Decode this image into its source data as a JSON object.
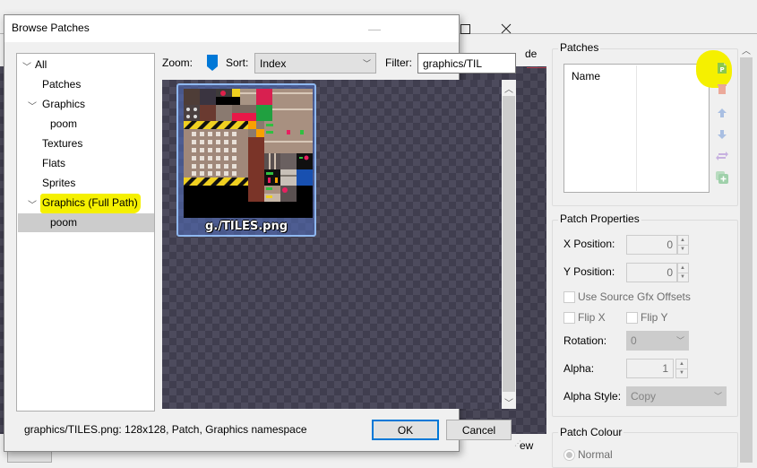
{
  "background": {
    "partial_label_right": "de",
    "partial_label_bottom": "ew"
  },
  "dialog": {
    "title": "Browse Patches",
    "window_controls": {
      "minimize": "—",
      "maximize": "☐",
      "close": "✕"
    },
    "tree": {
      "items": [
        {
          "label": "All",
          "expanded": true,
          "level": 0
        },
        {
          "label": "Patches",
          "level": 1
        },
        {
          "label": "Graphics",
          "expanded": true,
          "level": 1
        },
        {
          "label": "poom",
          "level": 2
        },
        {
          "label": "Textures",
          "level": 1
        },
        {
          "label": "Flats",
          "level": 1
        },
        {
          "label": "Sprites",
          "level": 1
        },
        {
          "label": "Graphics (Full Path)",
          "expanded": true,
          "level": 1,
          "highlighted": true
        },
        {
          "label": "poom",
          "level": 2,
          "selected": true
        }
      ]
    },
    "toolbar": {
      "zoom_label": "Zoom:",
      "sort_label": "Sort:",
      "sort_value": "Index",
      "filter_label": "Filter:",
      "filter_value": "graphics/TIL"
    },
    "gallery": {
      "items": [
        {
          "name": "g./TILES.png",
          "selected": true
        }
      ]
    },
    "status": "graphics/TILES.png: 128x128, Patch, Graphics namespace",
    "ok_label": "OK",
    "cancel_label": "Cancel"
  },
  "right_panel": {
    "patches": {
      "title": "Patches",
      "column_name": "Name",
      "icons": [
        "add-patch-icon",
        "remove-patch-icon",
        "move-up-icon",
        "move-down-icon",
        "replace-patch-icon",
        "duplicate-patch-icon"
      ]
    },
    "patch_properties": {
      "title": "Patch Properties",
      "x_position_label": "X Position:",
      "x_position_value": "0",
      "y_position_label": "Y Position:",
      "y_position_value": "0",
      "use_source_offsets_label": "Use Source Gfx Offsets",
      "flip_x_label": "Flip X",
      "flip_y_label": "Flip Y",
      "rotation_label": "Rotation:",
      "rotation_value": "0",
      "alpha_label": "Alpha:",
      "alpha_value": "1",
      "alpha_style_label": "Alpha Style:",
      "alpha_style_value": "Copy"
    },
    "patch_colour": {
      "title": "Patch Colour",
      "normal_label": "Normal"
    }
  },
  "colors": {
    "accent": "#0078d7",
    "highlight": "#f5f000",
    "selection": "#cccccc"
  }
}
